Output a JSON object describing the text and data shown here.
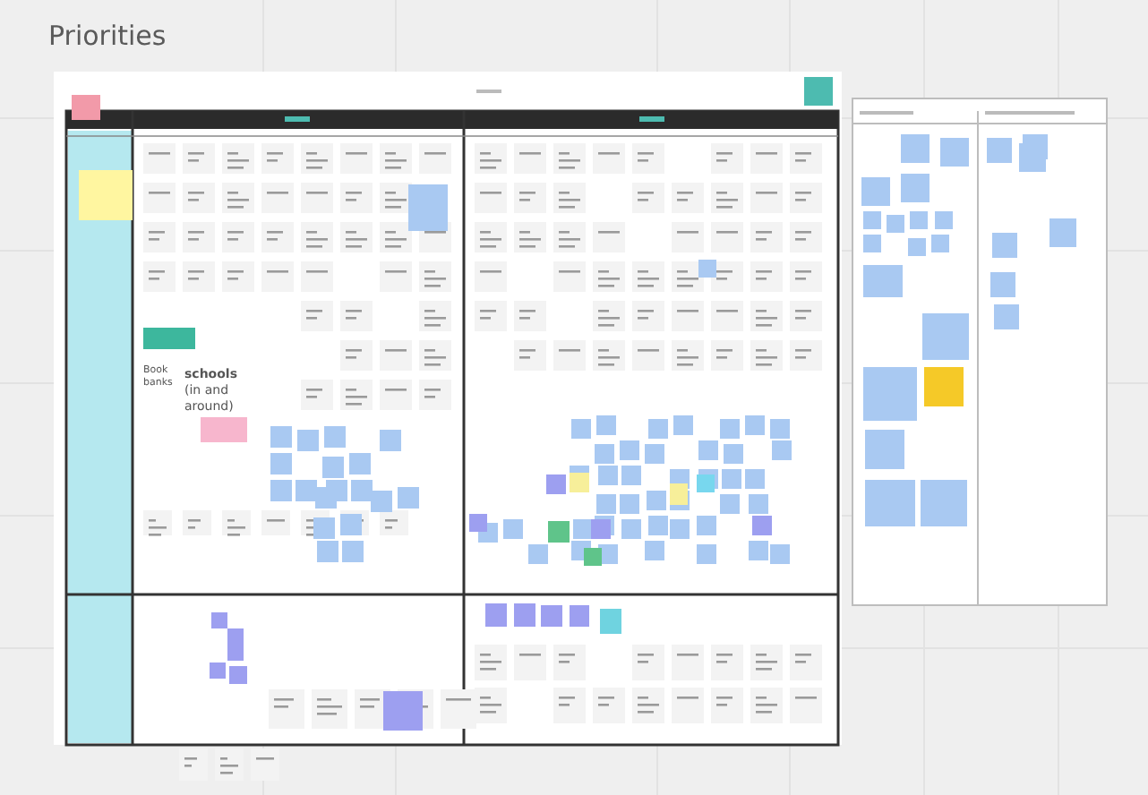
{
  "board": {
    "title": "Priorities"
  },
  "notes": [
    {
      "text": "Book banks"
    },
    {
      "text": "**schools** (in and around)"
    }
  ]
}
